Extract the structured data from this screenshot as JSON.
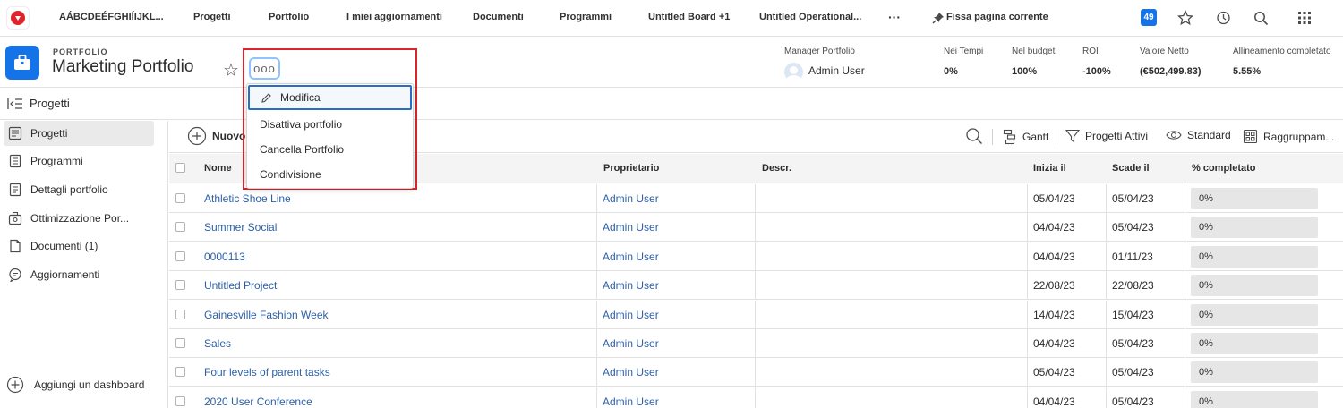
{
  "topnav": {
    "items": [
      "AÁBCDEÉFGHIÍIJKL...",
      "Progetti",
      "Portfolio",
      "I miei aggiornamenti",
      "Documenti",
      "Programmi",
      "Untitled Board +1",
      "Untitled Operational...",
      "Fissa pagina corrente"
    ],
    "more_label": "···",
    "notification_count": "49",
    "icons": [
      "logo-icon",
      "more-icon",
      "pin-icon",
      "notifications-badge",
      "star-icon",
      "history-icon",
      "search-icon",
      "apps-grid-icon"
    ]
  },
  "header": {
    "eyebrow": "PORTFOLIO",
    "title": "Marketing Portfolio",
    "more_button": "ooo",
    "manager_label": "Manager Portfolio",
    "manager_name": "Admin User",
    "metrics": [
      {
        "label": "Nei Tempi",
        "value": "0%"
      },
      {
        "label": "Nel budget",
        "value": "100%"
      },
      {
        "label": "ROI",
        "value": "-100%"
      },
      {
        "label": "Valore Netto",
        "value": "(€502,499.83)"
      },
      {
        "label": "Allineamento completato",
        "value": "5.55%"
      }
    ]
  },
  "section": {
    "title": "Progetti"
  },
  "sidebar": {
    "items": [
      {
        "label": "Progetti",
        "icon": "projects-icon",
        "active": true
      },
      {
        "label": "Programmi",
        "icon": "programs-icon"
      },
      {
        "label": "Dettagli portfolio",
        "icon": "details-icon"
      },
      {
        "label": "Ottimizzazione Por...",
        "icon": "optimizer-icon"
      },
      {
        "label": "Documenti (1)",
        "icon": "document-icon"
      },
      {
        "label": "Aggiornamenti",
        "icon": "comment-icon"
      }
    ],
    "add_dashboard": "Aggiungi un dashboard"
  },
  "toolbar": {
    "new_label": "Nuovo",
    "gantt": "Gantt",
    "filter": "Progetti Attivi",
    "view": "Standard",
    "grouping": "Raggruppam..."
  },
  "menu": {
    "items": [
      "Modifica",
      "Disattiva portfolio",
      "Cancella Portfolio",
      "Condivisione"
    ]
  },
  "table": {
    "columns": [
      "Nome",
      "Proprietario",
      "Descr.",
      "Inizia il",
      "Scade il",
      "% completato"
    ],
    "rows": [
      {
        "name": "Athletic Shoe Line",
        "owner": "Admin User",
        "desc": "",
        "start": "05/04/23",
        "end": "05/04/23",
        "pct": "0%",
        "pct_value": 0
      },
      {
        "name": "Summer Social",
        "owner": "Admin User",
        "desc": "",
        "start": "04/04/23",
        "end": "05/04/23",
        "pct": "0%",
        "pct_value": 0
      },
      {
        "name": "0000113",
        "owner": "Admin User",
        "desc": "",
        "start": "04/04/23",
        "end": "01/11/23",
        "pct": "0%",
        "pct_value": 0
      },
      {
        "name": "Untitled Project",
        "owner": "Admin User",
        "desc": "",
        "start": "22/08/23",
        "end": "22/08/23",
        "pct": "0%",
        "pct_value": 0
      },
      {
        "name": "Gainesville Fashion Week",
        "owner": "Admin User",
        "desc": "",
        "start": "14/04/23",
        "end": "15/04/23",
        "pct": "0%",
        "pct_value": 0
      },
      {
        "name": "Sales",
        "owner": "Admin User",
        "desc": "",
        "start": "04/04/23",
        "end": "05/04/23",
        "pct": "0%",
        "pct_value": 0
      },
      {
        "name": "Four levels of parent tasks",
        "owner": "Admin User",
        "desc": "",
        "start": "05/04/23",
        "end": "05/04/23",
        "pct": "0%",
        "pct_value": 0
      },
      {
        "name": "2020 User Conference",
        "owner": "Admin User",
        "desc": "",
        "start": "04/04/23",
        "end": "05/04/23",
        "pct": "0%",
        "pct_value": 0
      }
    ]
  },
  "colors": {
    "accent": "#1473e6",
    "link": "#2c5fa8",
    "highlight": "#d7252b",
    "brand": "#e0242b"
  }
}
